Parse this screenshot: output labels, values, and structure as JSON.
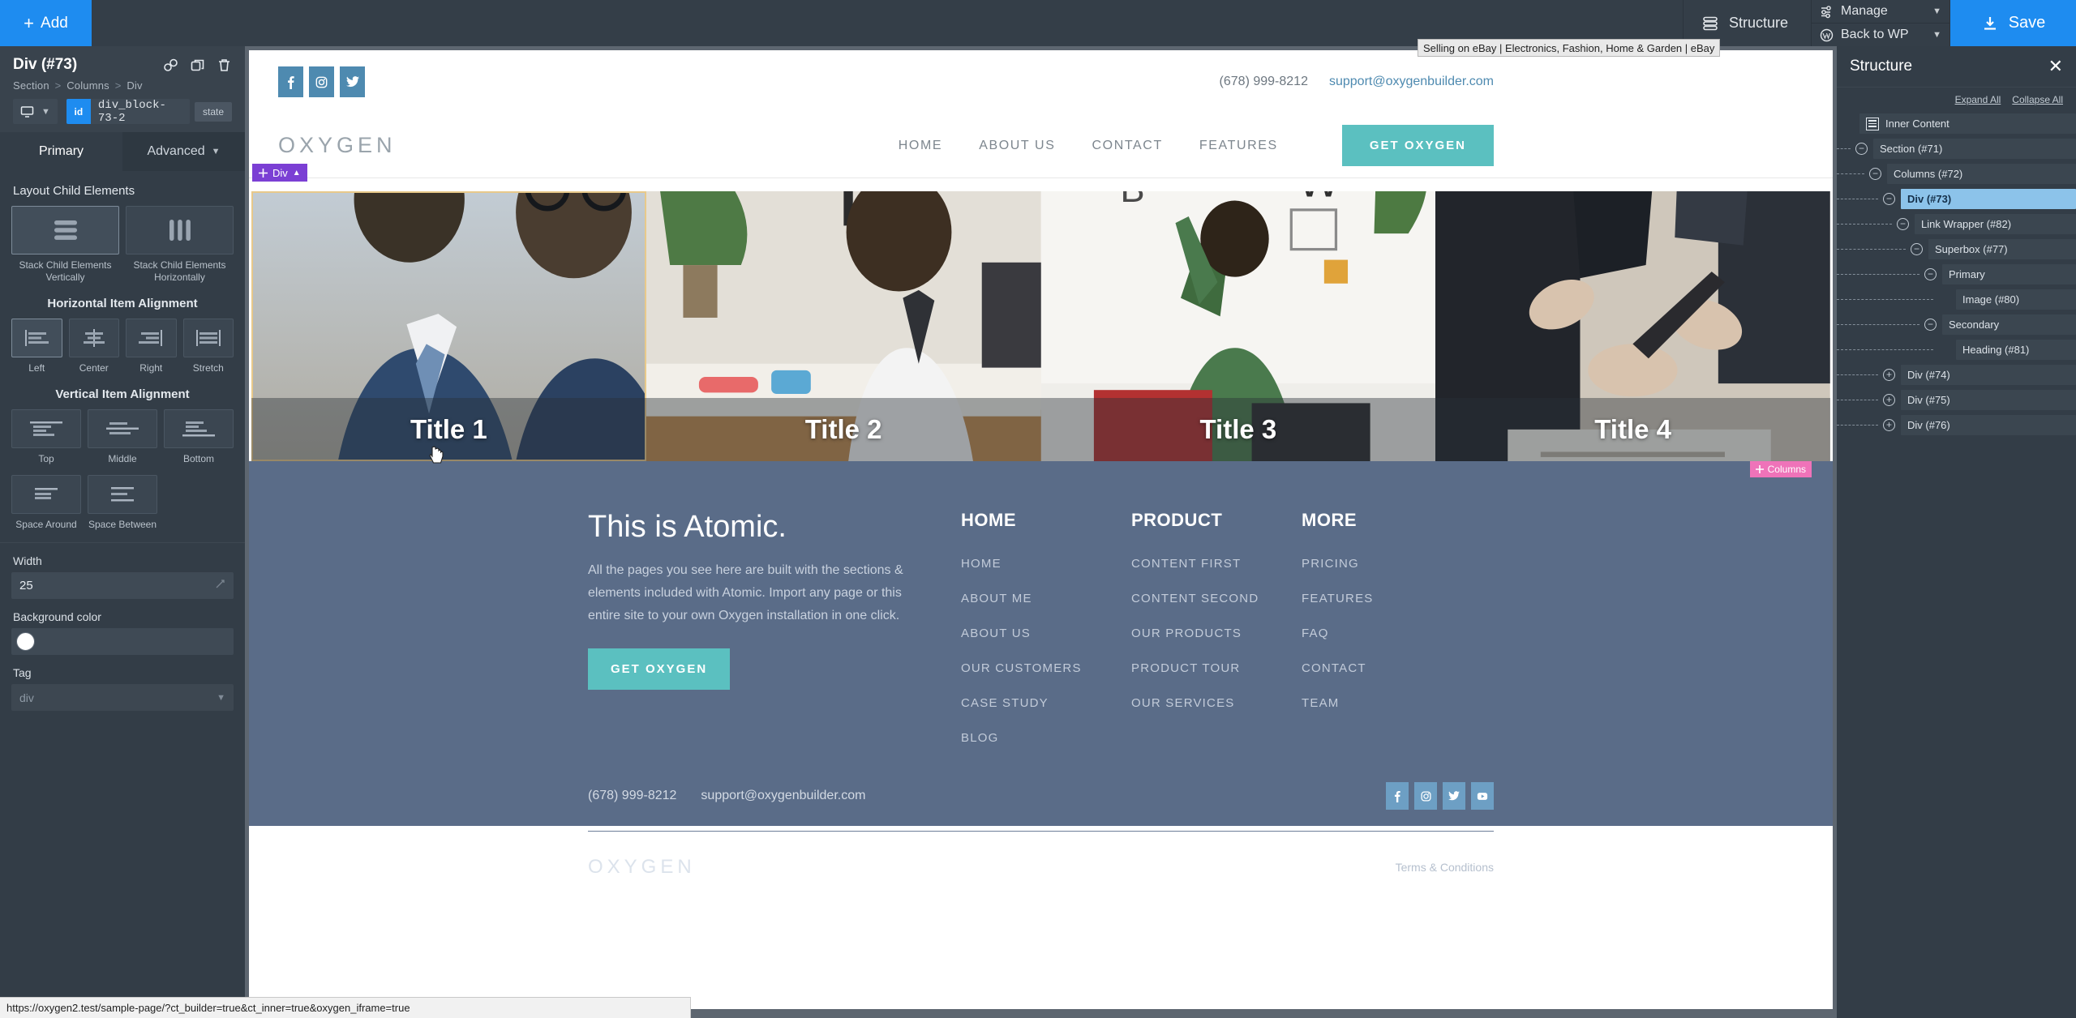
{
  "topbar": {
    "add_label": "Add",
    "structure_label": "Structure",
    "manage_label": "Manage",
    "back_to_wp_label": "Back to WP",
    "save_label": "Save"
  },
  "left_panel": {
    "title": "Div (#73)",
    "breadcrumb": [
      "Section",
      "Columns",
      "Div"
    ],
    "id_badge": "id",
    "id_value": "div_block-73-2",
    "state_label": "state",
    "tabs": [
      {
        "label": "Primary",
        "active": true
      },
      {
        "label": "Advanced",
        "active": false
      }
    ],
    "layout_section": {
      "label": "Layout Child Elements",
      "options": [
        {
          "label": "Stack Child Elements Vertically",
          "selected": true
        },
        {
          "label": "Stack Child Elements Horizontally",
          "selected": false
        }
      ]
    },
    "horizontal_alignment": {
      "label": "Horizontal Item Alignment",
      "options": [
        {
          "label": "Left",
          "selected": true
        },
        {
          "label": "Center",
          "selected": false
        },
        {
          "label": "Right",
          "selected": false
        },
        {
          "label": "Stretch",
          "selected": false
        }
      ]
    },
    "vertical_alignment": {
      "label": "Vertical Item Alignment",
      "options": [
        {
          "label": "Top",
          "selected": false
        },
        {
          "label": "Middle",
          "selected": false
        },
        {
          "label": "Bottom",
          "selected": false
        },
        {
          "label": "Space Around",
          "selected": false
        },
        {
          "label": "Space Between",
          "selected": false
        }
      ]
    },
    "width": {
      "label": "Width",
      "value": "25"
    },
    "background_color": {
      "label": "Background color",
      "value": "#ffffff"
    },
    "tag": {
      "label": "Tag",
      "value": "div"
    }
  },
  "canvas": {
    "tooltip": "Selling on eBay | Electronics, Fashion, Home & Garden | eBay",
    "div_badge": "Div",
    "columns_badge": "Columns",
    "site_header": {
      "logo": "OXYGEN",
      "phone": "(678) 999-8212",
      "email": "support@oxygenbuilder.com",
      "nav": [
        "HOME",
        "ABOUT US",
        "CONTACT",
        "FEATURES"
      ],
      "cta": "GET OXYGEN",
      "social": [
        "facebook-icon",
        "instagram-icon",
        "twitter-icon"
      ]
    },
    "tiles": [
      {
        "title": "Title 1",
        "selected": true
      },
      {
        "title": "Title 2",
        "selected": false
      },
      {
        "title": "Title 3",
        "selected": false
      },
      {
        "title": "Title 4",
        "selected": false
      }
    ],
    "footer": {
      "heading": "This is Atomic.",
      "paragraph": "All the pages you see here are built with the sections & elements included with Atomic. Import any page or this entire site to your own Oxygen installation in one click.",
      "cta": "GET OXYGEN",
      "columns": [
        {
          "heading": "HOME",
          "links": [
            "HOME",
            "ABOUT ME",
            "ABOUT US",
            "OUR CUSTOMERS",
            "CASE STUDY",
            "BLOG"
          ]
        },
        {
          "heading": "PRODUCT",
          "links": [
            "CONTENT FIRST",
            "CONTENT SECOND",
            "OUR PRODUCTS",
            "PRODUCT TOUR",
            "OUR SERVICES"
          ]
        },
        {
          "heading": "MORE",
          "links": [
            "PRICING",
            "FEATURES",
            "FAQ",
            "CONTACT",
            "TEAM"
          ]
        }
      ],
      "phone": "(678) 999-8212",
      "email": "support@oxygenbuilder.com",
      "social": [
        "facebook-icon",
        "instagram-icon",
        "twitter-icon",
        "youtube-icon"
      ],
      "logo": "OXYGEN",
      "terms": "Terms & Conditions"
    }
  },
  "structure": {
    "title": "Structure",
    "expand_all": "Expand All",
    "collapse_all": "Collapse All",
    "nodes": [
      {
        "label": "Inner Content",
        "depth": 0,
        "toggle": "none",
        "selected": false
      },
      {
        "label": "Section (#71)",
        "depth": 1,
        "toggle": "minus",
        "selected": false
      },
      {
        "label": "Columns (#72)",
        "depth": 2,
        "toggle": "minus",
        "selected": false
      },
      {
        "label": "Div (#73)",
        "depth": 3,
        "toggle": "minus",
        "selected": true
      },
      {
        "label": "Link Wrapper (#82)",
        "depth": 4,
        "toggle": "minus",
        "selected": false
      },
      {
        "label": "Superbox (#77)",
        "depth": 5,
        "toggle": "minus",
        "selected": false
      },
      {
        "label": "Primary",
        "depth": 6,
        "toggle": "minus",
        "selected": false
      },
      {
        "label": "Image (#80)",
        "depth": 7,
        "toggle": "none",
        "selected": false
      },
      {
        "label": "Secondary",
        "depth": 6,
        "toggle": "minus",
        "selected": false
      },
      {
        "label": "Heading (#81)",
        "depth": 7,
        "toggle": "none",
        "selected": false
      },
      {
        "label": "Div (#74)",
        "depth": 3,
        "toggle": "plus",
        "selected": false
      },
      {
        "label": "Div (#75)",
        "depth": 3,
        "toggle": "plus",
        "selected": false
      },
      {
        "label": "Div (#76)",
        "depth": 3,
        "toggle": "plus",
        "selected": false
      }
    ]
  },
  "statusbar": {
    "url": "https://oxygen2.test/sample-page/?ct_builder=true&ct_inner=true&oxygen_iframe=true"
  }
}
